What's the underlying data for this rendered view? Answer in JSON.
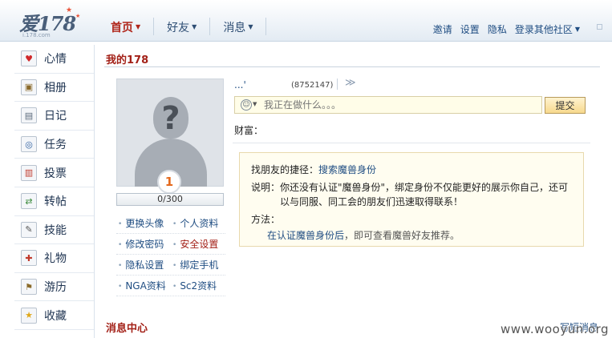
{
  "logo": {
    "main": "爱178",
    "sub": "i.178.com"
  },
  "nav": [
    {
      "label": "首页",
      "active": true
    },
    {
      "label": "好友",
      "active": false
    },
    {
      "label": "消息",
      "active": false
    }
  ],
  "toplinks": [
    "邀请",
    "设置",
    "隐私",
    "登录其他社区"
  ],
  "sidebar": [
    {
      "label": "心情",
      "icon": "heart-icon",
      "glyph": "♥",
      "color": "#d0282a"
    },
    {
      "label": "相册",
      "icon": "album-icon",
      "glyph": "▣",
      "color": "#8a6a2a"
    },
    {
      "label": "日记",
      "icon": "diary-icon",
      "glyph": "▤",
      "color": "#5b6b7c"
    },
    {
      "label": "任务",
      "icon": "task-icon",
      "glyph": "◎",
      "color": "#2d5fa0"
    },
    {
      "label": "投票",
      "icon": "vote-icon",
      "glyph": "▥",
      "color": "#c0392b"
    },
    {
      "label": "转帖",
      "icon": "repost-icon",
      "glyph": "⇄",
      "color": "#3a8a3a"
    },
    {
      "label": "技能",
      "icon": "skill-icon",
      "glyph": "✎",
      "color": "#555555"
    },
    {
      "label": "礼物",
      "icon": "gift-icon",
      "glyph": "✚",
      "color": "#c0392b"
    },
    {
      "label": "游历",
      "icon": "travel-icon",
      "glyph": "⚑",
      "color": "#8a6a2a"
    },
    {
      "label": "收藏",
      "icon": "star-icon",
      "glyph": "★",
      "color": "#e0a81a"
    }
  ],
  "page_title": "我的178",
  "profile": {
    "avatar_glyph": "?",
    "level": "1",
    "progress_text": "0/300",
    "progress_fraction": 0,
    "name": "...'",
    "id": "(8752147)",
    "expand_glyph": "≫",
    "links": [
      [
        "更换头像",
        "个人资料"
      ],
      [
        "修改密码",
        "安全设置"
      ],
      [
        "隐私设置",
        "绑定手机"
      ],
      [
        "NGA资料",
        "Sc2资料"
      ]
    ]
  },
  "status": {
    "placeholder": "我正在做什么。。。",
    "submit": "提交",
    "globe": "☺"
  },
  "wealth_label": "财富：",
  "info": {
    "shortcut_label": "找朋友的捷径：",
    "shortcut_link": "搜索魔兽身份",
    "desc_label": "说明：",
    "desc_line1": "你还没有认证\"魔兽身份\"，绑定身份不仅能更好的展示你自己，还可",
    "desc_line2": "以与同服、同工会的朋友们迅速取得联系！",
    "method_label": "方法：",
    "method_link": "在认证魔兽身份后",
    "method_text": "，即可查看魔兽好友推荐。"
  },
  "message_center": {
    "title": "消息中心",
    "link": "写短消息"
  },
  "watermark": "www.wooyun.org"
}
